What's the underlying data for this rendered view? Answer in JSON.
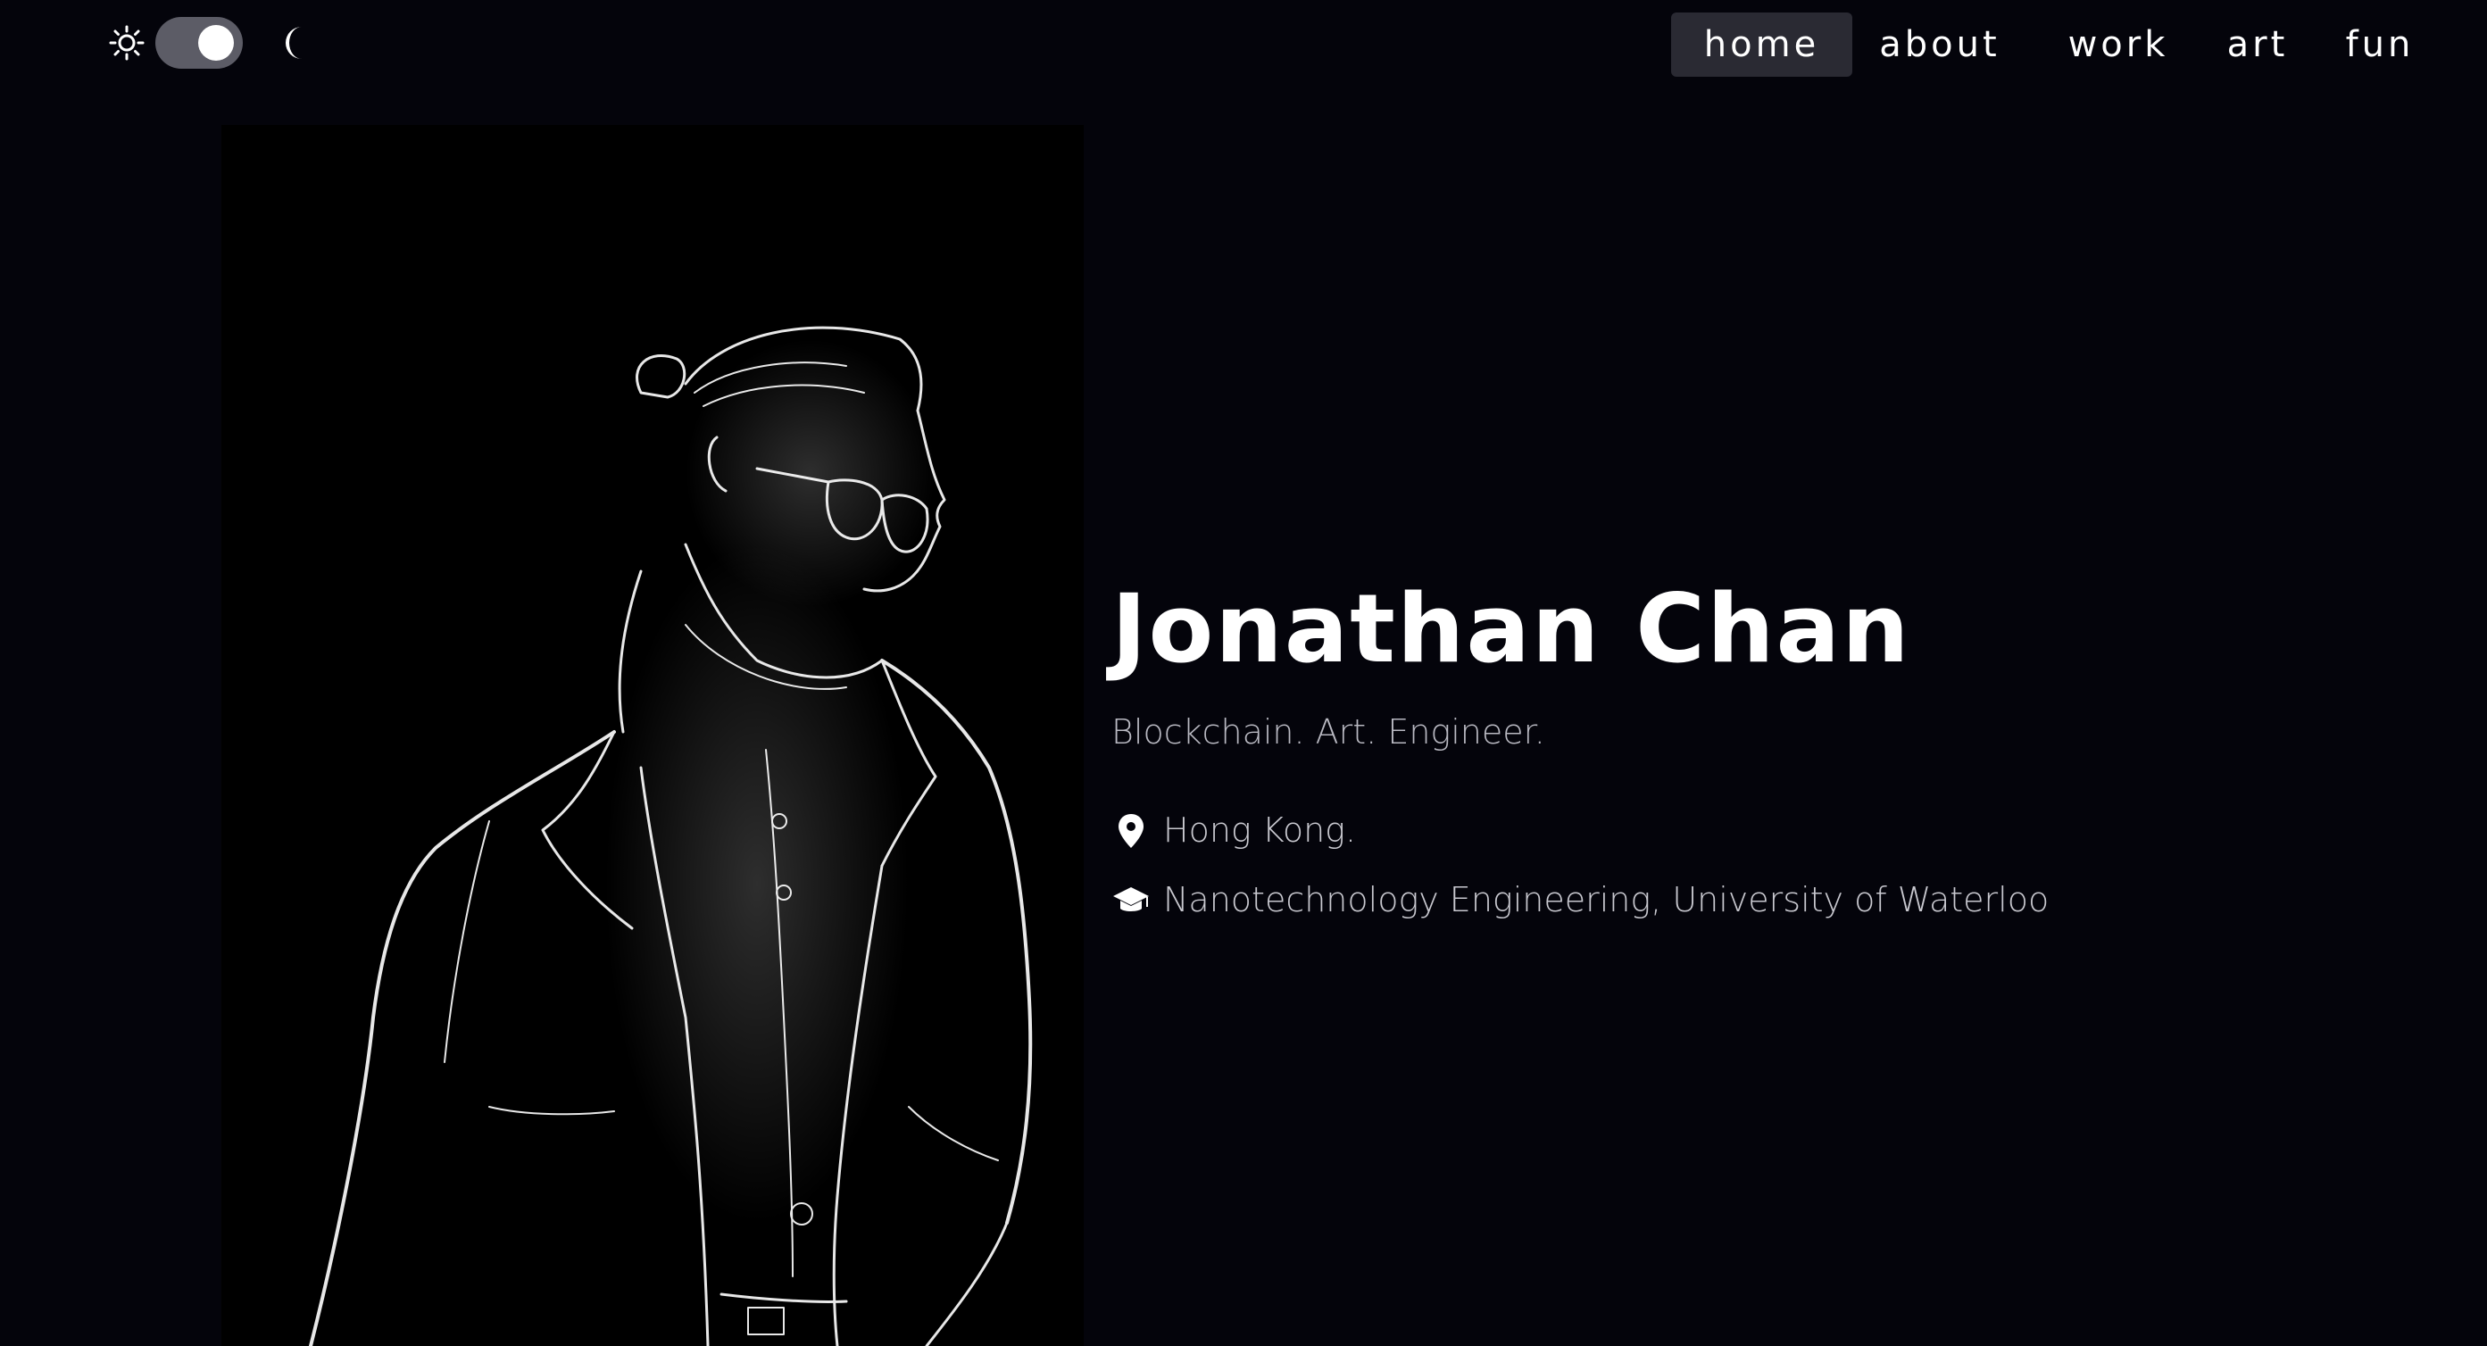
{
  "theme_toggle": {
    "light_icon": "sun-icon",
    "dark_icon": "moon-icon",
    "state": "dark"
  },
  "nav": {
    "items": [
      {
        "label": "home",
        "active": true
      },
      {
        "label": "about",
        "active": false
      },
      {
        "label": "work",
        "active": false
      },
      {
        "label": "art",
        "active": false
      },
      {
        "label": "fun",
        "active": false
      }
    ]
  },
  "portrait": {
    "icon": "portrait-sketch"
  },
  "intro": {
    "name": "Jonathan Chan",
    "tagline": "Blockchain. Art. Engineer.",
    "location": {
      "icon": "location-pin-icon",
      "text": "Hong Kong."
    },
    "education": {
      "icon": "graduation-cap-icon",
      "text": "Nanotechnology Engineering, University of Waterloo"
    }
  },
  "colors": {
    "background": "#04040b",
    "nav_active_bg": "#2a2a33",
    "toggle_track": "#5c5c66",
    "text_primary": "#ffffff",
    "text_secondary": "#b9b9c2"
  }
}
